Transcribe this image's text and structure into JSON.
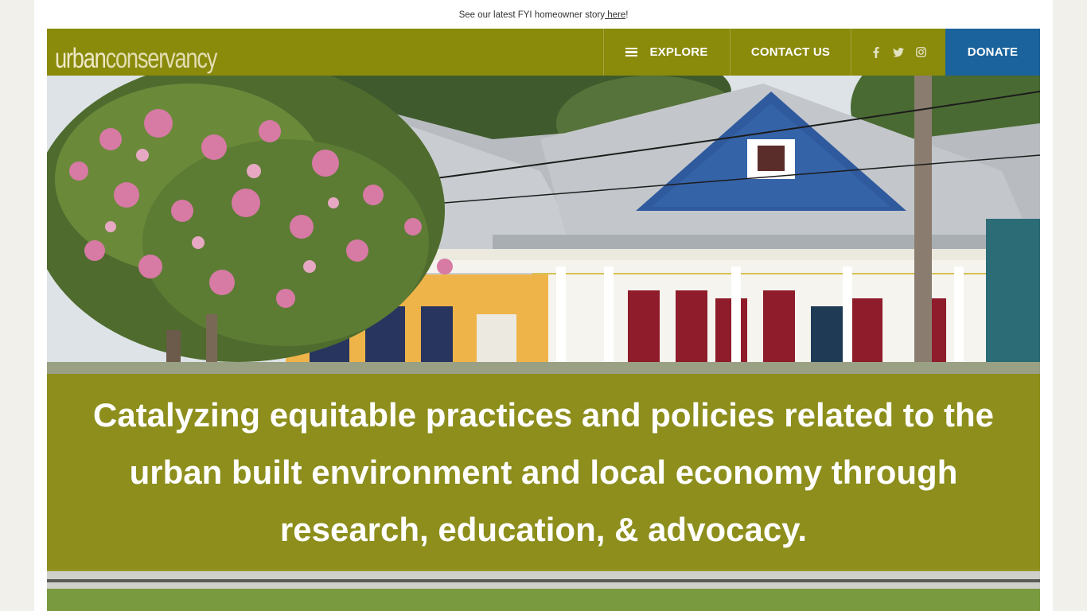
{
  "announcement": {
    "text": "See our latest FYI homeowner story",
    "link_text": " here",
    "suffix": "!"
  },
  "header": {
    "logo_part1": "urban",
    "logo_part2": "conservancy",
    "nav": {
      "explore_label": "EXPLORE",
      "contact_label": "CONTACT US",
      "donate_label": "DONATE"
    },
    "social": [
      "facebook-icon",
      "twitter-icon",
      "instagram-icon"
    ]
  },
  "hero": {
    "tagline": "Catalyzing equitable practices and policies related to the urban built environment and local economy through research, education, & advocacy."
  },
  "colors": {
    "brand_olive": "#8a8a0b",
    "donate_blue": "#1a639c",
    "page_bg": "#f1f0eb"
  }
}
